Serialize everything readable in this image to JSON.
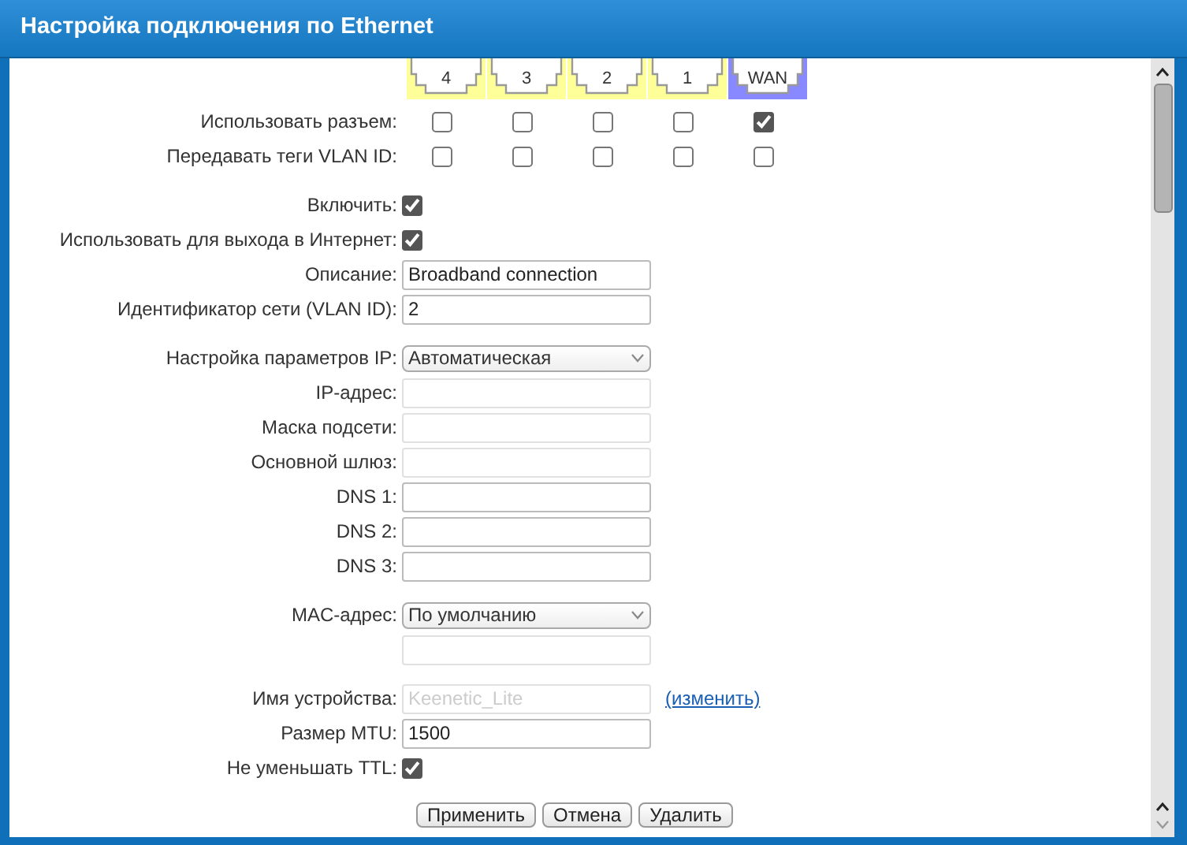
{
  "window": {
    "title": "Настройка подключения по Ethernet"
  },
  "ports": [
    {
      "label": "4",
      "color": "#ffff99"
    },
    {
      "label": "3",
      "color": "#ffff99"
    },
    {
      "label": "2",
      "color": "#ffff99"
    },
    {
      "label": "1",
      "color": "#ffff99"
    },
    {
      "label": "WAN",
      "color": "#8888ff"
    }
  ],
  "port_rows": [
    {
      "label": "Использовать разъем:",
      "checks": [
        false,
        false,
        false,
        false,
        true
      ]
    },
    {
      "label": "Передавать теги VLAN ID:",
      "checks": [
        false,
        false,
        false,
        false,
        false
      ]
    }
  ],
  "sections": [
    [
      {
        "kind": "checkbox",
        "label": "Включить:",
        "checked": true
      },
      {
        "kind": "checkbox",
        "label": "Использовать для выхода в Интернет:",
        "checked": true
      },
      {
        "kind": "text",
        "label": "Описание:",
        "value": "Broadband connection",
        "disabled": false
      },
      {
        "kind": "text",
        "label": "Идентификатор сети (VLAN ID):",
        "value": "2",
        "disabled": false
      }
    ],
    [
      {
        "kind": "select",
        "label": "Настройка параметров IP:",
        "value": "Автоматическая"
      },
      {
        "kind": "text",
        "label": "IP-адрес:",
        "disabled": true
      },
      {
        "kind": "text",
        "label": "Маска подсети:",
        "disabled": true
      },
      {
        "kind": "text",
        "label": "Основной шлюз:",
        "disabled": true
      },
      {
        "kind": "text",
        "label": "DNS 1:",
        "disabled": false
      },
      {
        "kind": "text",
        "label": "DNS 2:",
        "disabled": false
      },
      {
        "kind": "text",
        "label": "DNS 3:",
        "disabled": false
      }
    ],
    [
      {
        "kind": "select",
        "label": "MAC-адрес:",
        "value": "По умолчанию"
      },
      {
        "kind": "text",
        "disabled": true
      }
    ],
    [
      {
        "kind": "text",
        "label": "Имя устройства:",
        "value": "Keenetic_Lite",
        "disabled": true,
        "link": "(изменить)"
      },
      {
        "kind": "text",
        "label": "Размер MTU:",
        "value": "1500",
        "disabled": false
      },
      {
        "kind": "checkbox",
        "label": "Не уменьшать TTL:",
        "checked": true
      }
    ]
  ],
  "buttons": [
    "Применить",
    "Отмена",
    "Удалить"
  ]
}
